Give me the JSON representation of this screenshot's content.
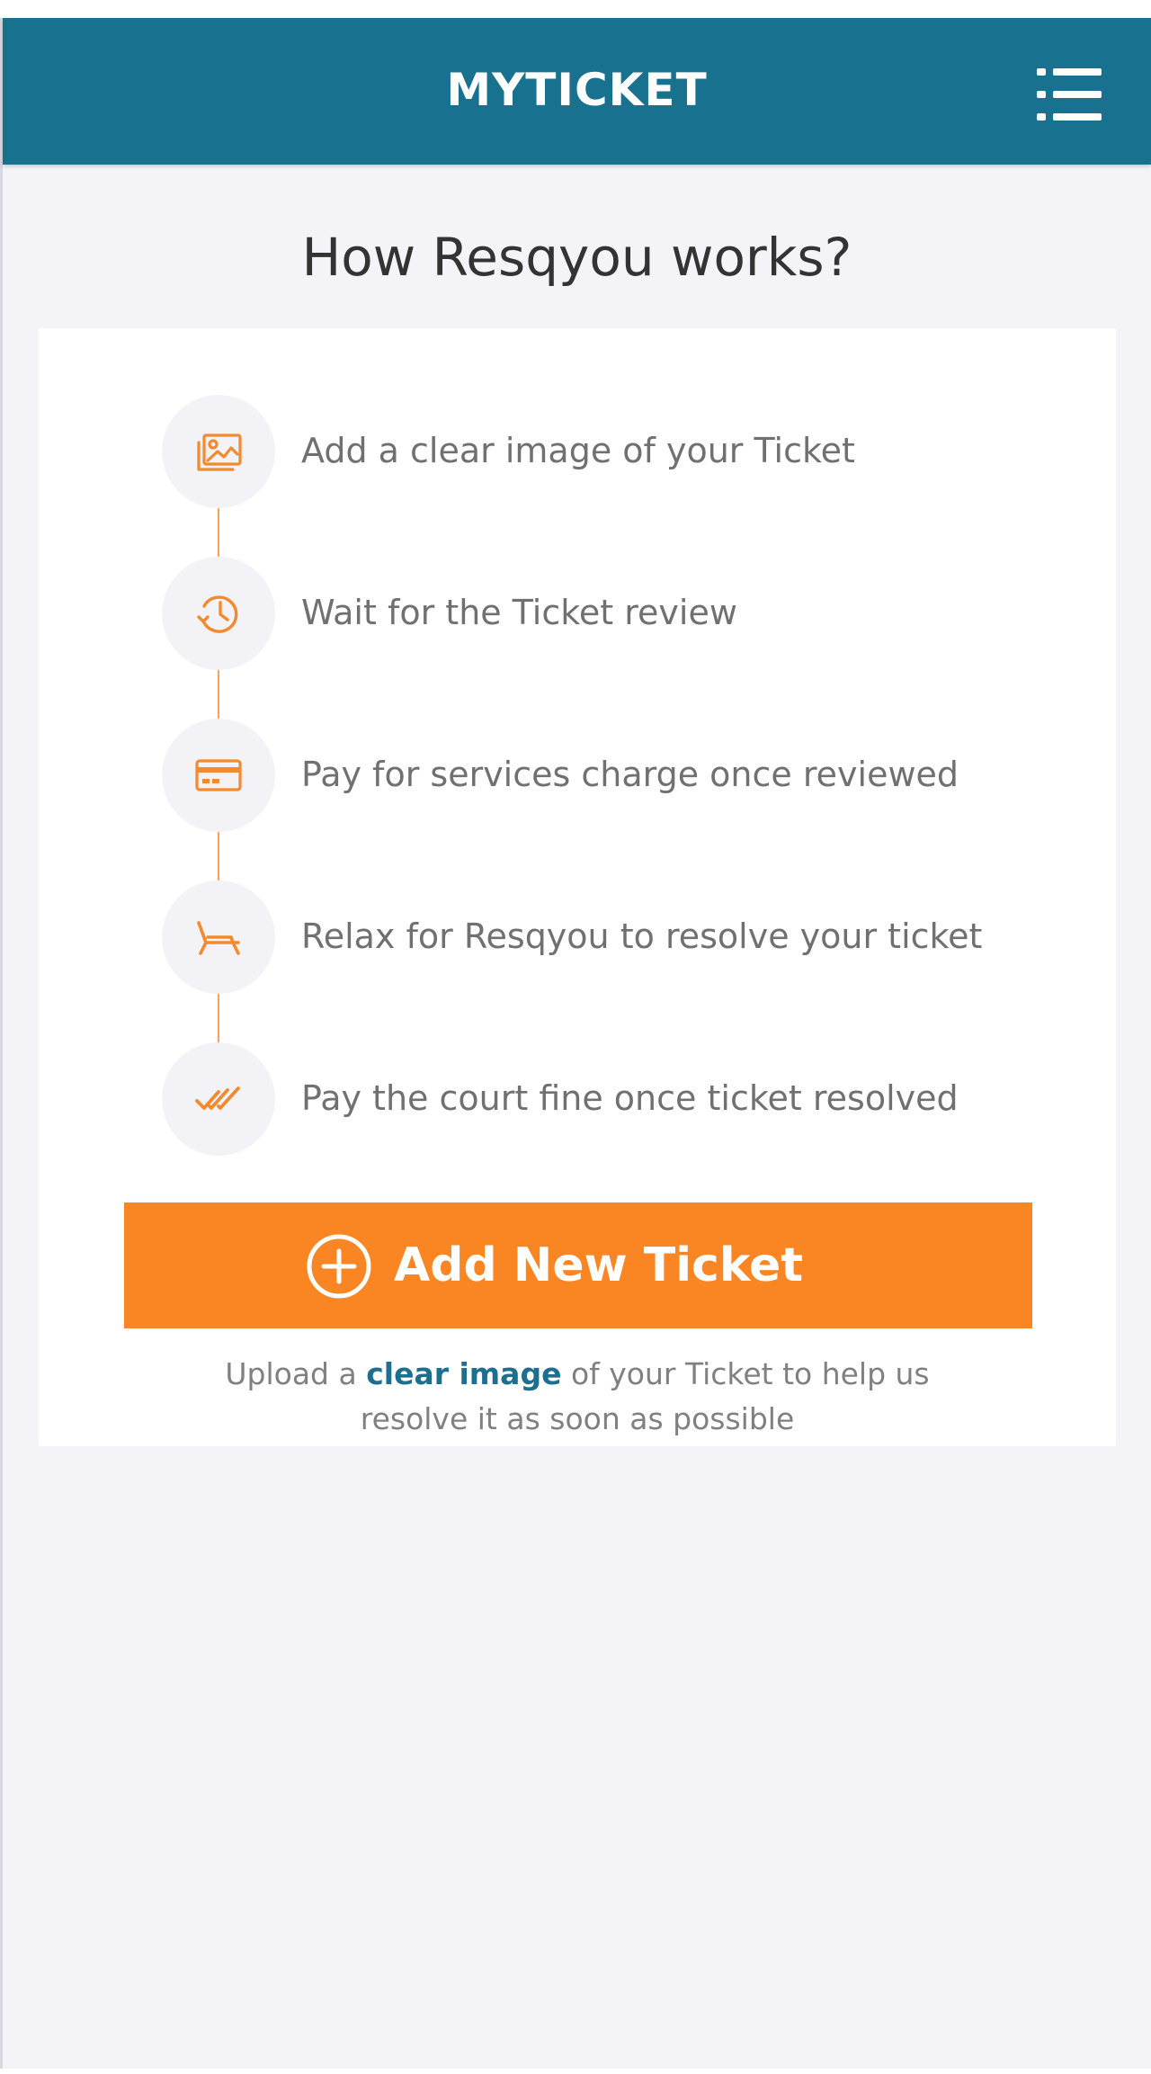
{
  "app_bar": {
    "title": "MYTICKET",
    "menu_icon": "list-menu-icon",
    "background_color": "#18718e"
  },
  "main": {
    "heading": "How Resqyou works?",
    "steps": [
      {
        "icon": "image-icon",
        "text": "Add a clear image of your Ticket"
      },
      {
        "icon": "history-clock-icon",
        "text": "Wait for the Ticket review"
      },
      {
        "icon": "credit-card-icon",
        "text": "Pay for services charge once reviewed"
      },
      {
        "icon": "lounge-chair-icon",
        "text": "Relax for Resqyou to resolve your ticket"
      },
      {
        "icon": "double-check-icon",
        "text": "Pay the court fine once ticket resolved"
      }
    ],
    "add_button": {
      "label": "Add New Ticket",
      "icon": "plus-circle-icon",
      "color": "#fa8623"
    },
    "help_text": {
      "before_link": "Upload a",
      "link": "clear image",
      "after_link": "of your Ticket to help us",
      "line2": "resolve it as soon as possible"
    }
  },
  "colors": {
    "accent_orange": "#fa8623",
    "icon_orange": "#f28a2e",
    "link_blue": "#1d6f8f",
    "page_background": "#f4f3f7"
  }
}
